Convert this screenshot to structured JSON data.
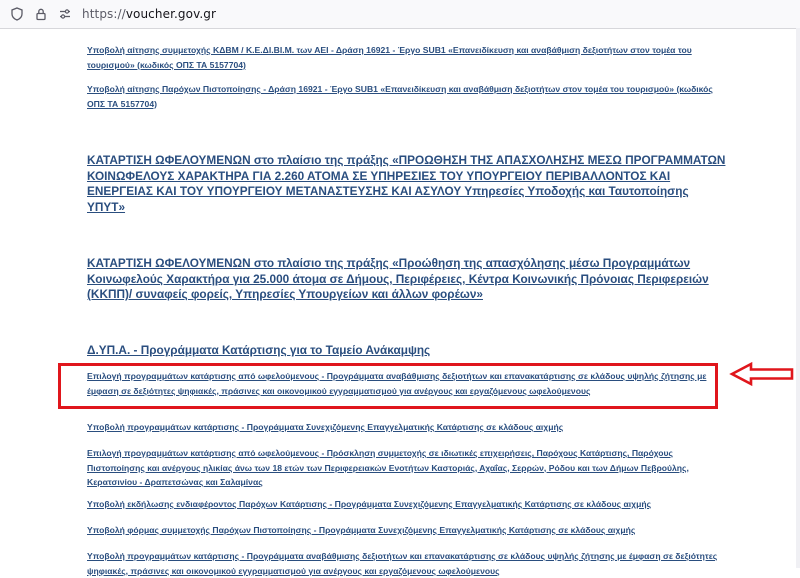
{
  "browser": {
    "url_scheme": "https://",
    "url_host": "voucher.gov.gr"
  },
  "links": {
    "kdvm": "Υποβολή αίτησης συμμετοχής ΚΔΒΜ / Κ.Ε.ΔΙ.ΒΙ.Μ. των ΑΕΙ - Δράση 16921 - Έργο SUB1 «Επανειδίκευση και αναβάθμιση δεξιοτήτων στον τομέα του τουρισμού» (κωδικός ΟΠΣ ΤΑ 5157704)",
    "paroxoi_pistopoiisis": "Υποβολή αίτησης Παρόχων Πιστοποίησης - Δράση 16921 - Έργο SUB1 «Επανειδίκευση και αναβάθμιση δεξιοτήτων στον τομέα του τουρισμού» (κωδικός ΟΠΣ ΤΑ 5157704)",
    "heading_2260": "ΚΑΤΑΡΤΙΣΗ ΩΦΕΛΟΥΜΕΝΩΝ στο πλαίσιο της πράξης «ΠΡΟΩΘΗΣΗ ΤΗΣ ΑΠΑΣΧΟΛΗΣΗΣ ΜΕΣΩ ΠΡΟΓΡΑΜΜΑΤΩΝ ΚΟΙΝΩΦΕΛΟΥΣ ΧΑΡΑΚΤΗΡΑ ΓΙΑ 2.260 ΑΤΟΜΑ ΣΕ ΥΠΗΡΕΣΙΕΣ ΤΟΥ ΥΠΟΥΡΓΕΙΟΥ ΠΕΡΙΒΑΛΛΟΝΤΟΣ ΚΑΙ ΕΝΕΡΓΕΙΑΣ ΚΑΙ ΤΟΥ ΥΠΟΥΡΓΕΙΟΥ ΜΕΤΑΝΑΣΤΕΥΣΗΣ ΚΑΙ ΑΣΥΛΟΥ Υπηρεσίες Υποδοχής και Ταυτοποίησης ΥΠΥΤ»",
    "heading_25000": "ΚΑΤΑΡΤΙΣΗ ΩΦΕΛΟΥΜΕΝΩΝ στο πλαίσιο της πράξης «Προώθηση της απασχόλησης μέσω Προγραμμάτων Κοινωφελούς Χαρακτήρα για 25.000 άτομα σε Δήμους, Περιφέρειες, Κέντρα Κοινωνικής Πρόνοιας Περιφερειών (ΚΚΠΠ)/ συναφείς φορείς, Υπηρεσίες Υπουργείων και άλλων φορέων»",
    "dypa_heading": "Δ.ΥΠ.Α. - Προγράμματα Κατάρτισης για το Ταμείο Ανάκαμψης",
    "highlighted": "Επιλογή προγραμμάτων κατάρτισης από ωφελούμενους - Προγράμματα αναβάθμισης δεξιοτήτων και επανακατάρτισης σε κλάδους υψηλής ζήτησης με έμφαση σε δεξιότητες ψηφιακές, πράσινες και οικονομικού εγγραμματισμού για ανέργους και εργαζόμενους ωφελούμενους",
    "synexizomeni": "Υποβολή προγραμμάτων κατάρτισης - Προγράμματα Συνεχιζόμενης Επαγγελματικής Κατάρτισης σε κλάδους αιχμής",
    "prosklisi": "Επιλογή προγραμμάτων κατάρτισης από ωφελούμενους - Πρόσκληση συμμετοχής σε ιδιωτικές επιχειρήσεις, Παρόχους Κατάρτισης, Παρόχους Πιστοποίησης και ανέργους ηλικίας άνω των 18 ετών των Περιφερειακών Ενοτήτων Καστοριάς, Αχαΐας, Σερρών, Ρόδου και των Δήμων Πεβρούλης, Κερατσινίου - Δραπετσώνας και Σαλαμίνας",
    "endiaferon": "Υποβολή εκδήλωσης ενδιαφέροντος Παρόχων Κατάρτισης - Προγράμματα Συνεχιζόμενης Επαγγελματικής Κατάρτισης σε κλάδους αιχμής",
    "forma_symmetoxis": "Υποβολή φόρμας συμμετοχής Παρόχων Πιστοποίησης - Προγράμματα Συνεχιζόμενης Επαγγελματικής Κατάρτισης σε κλάδους αιχμής",
    "anavathmisi": "Υποβολή προγραμμάτων κατάρτισης - Προγράμματα αναβάθμισης δεξιοτήτων και επανακατάρτισης σε κλάδους υψηλής ζήτησης με έμφαση σε δεξιότητες ψηφιακές, πράσινες και οικονομικού εγγραμματισμού για ανέργους και εργαζόμενους ωφελούμενους"
  },
  "annotation": {
    "box_color": "#e0161c"
  }
}
